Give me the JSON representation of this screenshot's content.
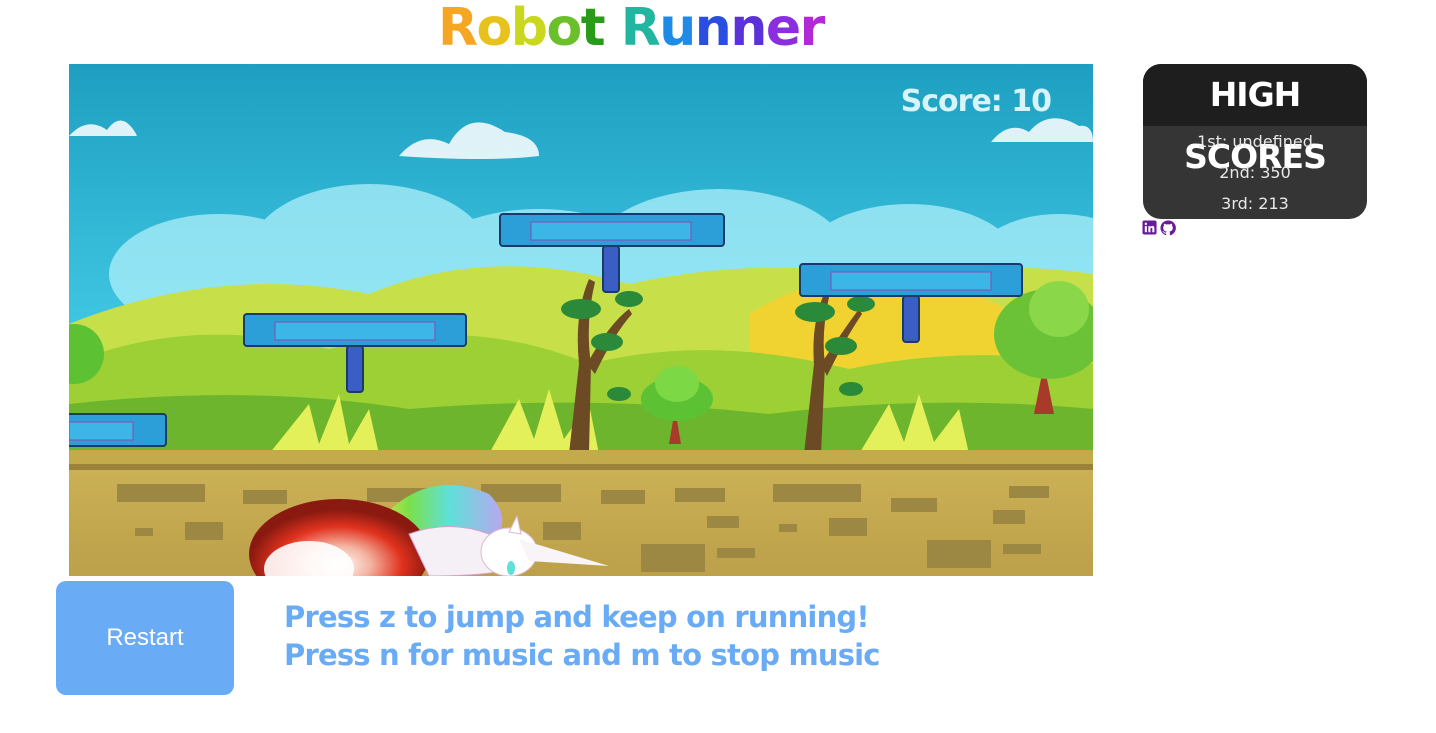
{
  "title": {
    "text": "Robot Runner",
    "colors": [
      "#f5a623",
      "#e8c21c",
      "#c9d81e",
      "#6bbf2a",
      "#2a9a1a",
      "#ffffff",
      "#22b5a0",
      "#1e8ce6",
      "#2a4fe0",
      "#5a32d8",
      "#8a2ee0",
      "#b12ad6"
    ]
  },
  "game": {
    "score_text": "Score: 10",
    "sky_color": "#39c2e0",
    "ground_color": "#c4a94e"
  },
  "high_scores": {
    "heading": "HIGH SCORES",
    "entries": [
      "1st: undefined",
      "2nd: 350",
      "3rd: 213"
    ]
  },
  "social": {
    "icons": [
      "linkedin-icon",
      "github-icon"
    ],
    "color": "#6a1b9a"
  },
  "controls": {
    "restart_label": "Restart",
    "instruction_1": "Press z to jump and keep on running!",
    "instruction_2": "Press n for music and m to stop music"
  }
}
